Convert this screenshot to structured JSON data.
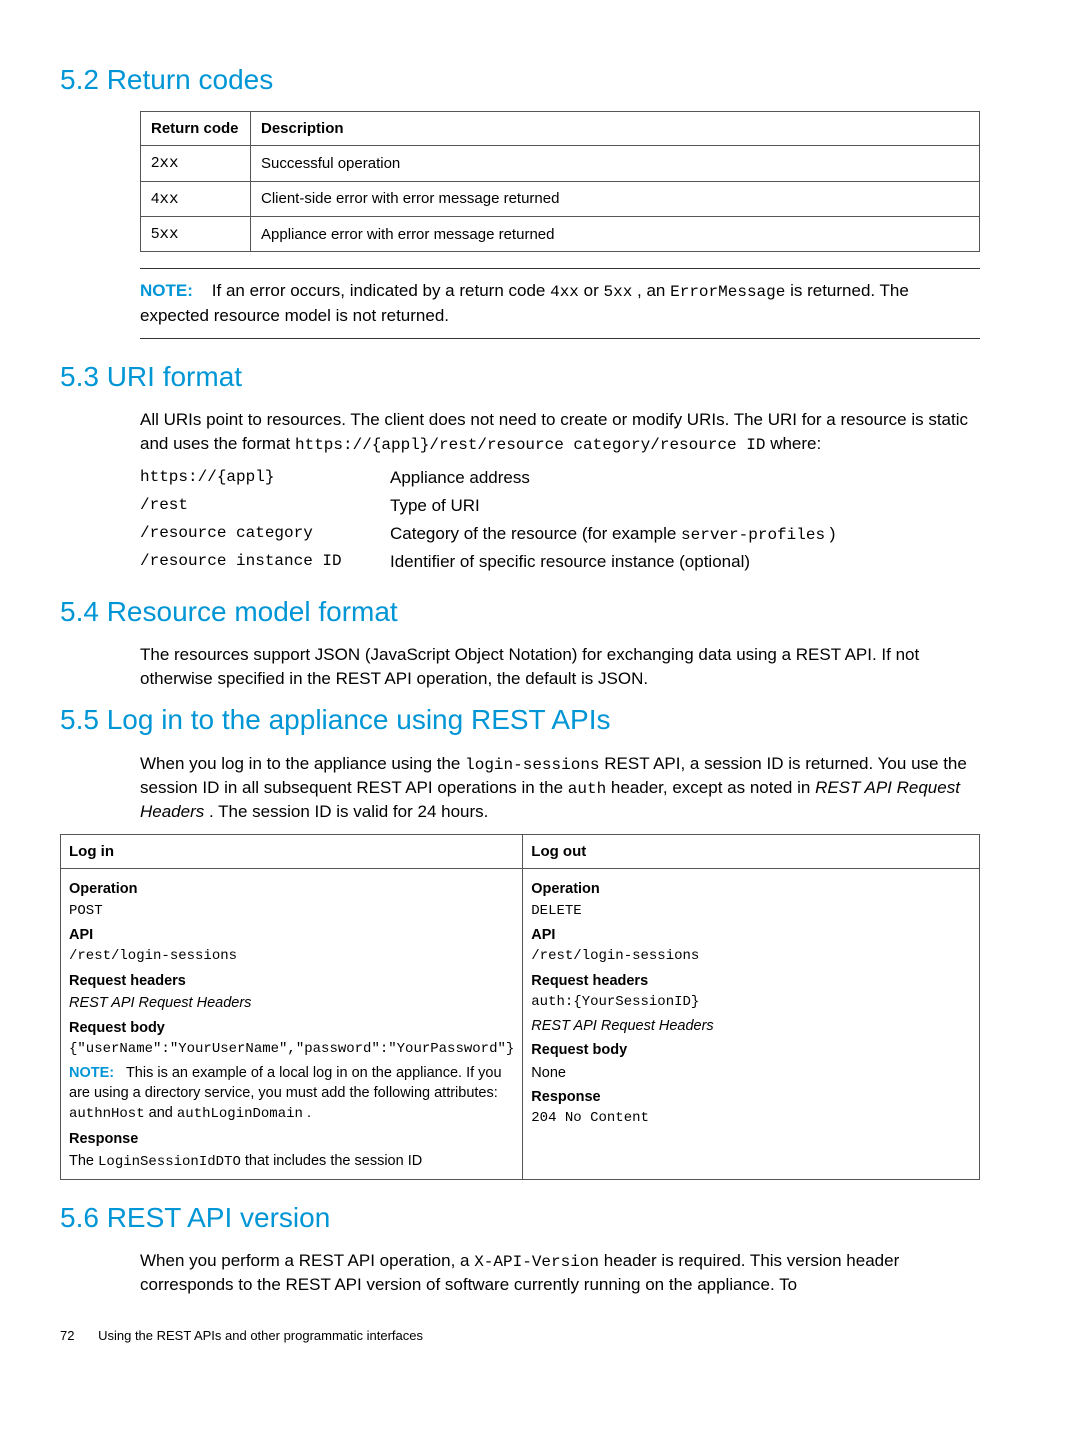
{
  "sections": {
    "returnCodes": {
      "heading": "5.2 Return codes",
      "headers": {
        "code": "Return code",
        "desc": "Description"
      },
      "rows": [
        {
          "code": "2",
          "desc": "Successful operation"
        },
        {
          "code": "4",
          "desc": "Client-side error with error message returned"
        },
        {
          "code": "5",
          "desc": "Appliance error with error message returned"
        }
      ],
      "note": {
        "label": "NOTE:",
        "p1a": "If an error occurs, indicated by a return code ",
        "c1": "4xx",
        "mid": " or ",
        "c2": "5xx",
        "p1b": ", an ",
        "c3": "ErrorMessage",
        "p1c": " is returned. The expected resource model is not returned."
      }
    },
    "uriFormat": {
      "heading": "5.3 URI format",
      "intro_a": "All URIs point to resources. The client does not need to create or modify URIs. The URI for a resource is static and uses the format ",
      "intro_code": "https://{appl}/rest/resource category/resource ID",
      "intro_b": " where:",
      "rows": [
        {
          "l": "https://{appl}",
          "r": "Appliance address"
        },
        {
          "l": "/rest",
          "r": "Type of URI"
        },
        {
          "l": "/resource category",
          "r_a": "Category of the resource (for example ",
          "r_code": "server-profiles",
          "r_b": ")"
        },
        {
          "l": "/resource instance ID",
          "r": "Identifier of specific resource instance (optional)"
        }
      ]
    },
    "resourceModel": {
      "heading": "5.4 Resource model format",
      "body": "The resources support JSON (JavaScript Object Notation) for exchanging data using a REST API. If not otherwise specified in the REST API operation, the default is JSON."
    },
    "login": {
      "heading": "5.5 Log in to the appliance using REST APIs",
      "intro_a": "When you log in to the appliance using the ",
      "intro_code1": "login-sessions",
      "intro_b": " REST API, a session ID is returned. You use the session ID in all subsequent REST API operations in the ",
      "intro_code2": "auth",
      "intro_c": " header, except as noted in ",
      "intro_ital": "REST API Request Headers",
      "intro_d": ". The session ID is valid for 24 hours.",
      "th_in": "Log in",
      "th_out": "Log out",
      "labels": {
        "operation": "Operation",
        "api": "API",
        "req_headers": "Request headers",
        "req_body": "Request body",
        "response": "Response",
        "notePrefix": "NOTE:"
      },
      "in": {
        "operation": "POST",
        "api": "/rest/login-sessions",
        "req_headers": "REST API Request Headers",
        "req_body": "{\"userName\":\"YourUserName\",\"password\":\"YourPassword\"}",
        "note": " This is an example of a local log in on the appliance. If you are using a directory service, you must add the following attributes: ",
        "note_code1": "authnHost",
        "note_mid": " and ",
        "note_code2": "authLoginDomain",
        "note_end": ".",
        "resp_a": "The ",
        "resp_code": "LoginSessionIdDTO",
        "resp_b": " that includes the session ID"
      },
      "out": {
        "operation": "DELETE",
        "api": "/rest/login-sessions",
        "req_headers": "auth:{YourSessionID}",
        "req_headers2": "REST API Request Headers",
        "req_body": "None",
        "response": "204 No Content"
      }
    },
    "version": {
      "heading": "5.6 REST API version",
      "body_a": "When you perform a REST API operation, a ",
      "body_code": "X-API-Version",
      "body_b": " header is required. This version header corresponds to the REST API version of software currently running on the appliance. To"
    }
  },
  "footer": {
    "page": "72",
    "chapter": "Using the REST APIs and other programmatic interfaces"
  }
}
